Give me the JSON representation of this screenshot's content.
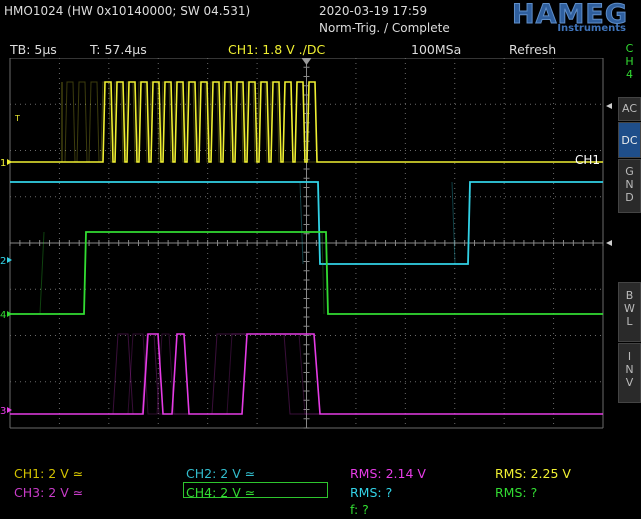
{
  "header": {
    "device": "HMO1024 (HW 0x10140000; SW 04.531)",
    "datetime": "2020-03-19 17:59",
    "trigger_status": "Norm-Trig. / Complete",
    "logo": "HAMEG",
    "logo_sub": "Instruments"
  },
  "settings_bar": {
    "timebase": "TB: 5µs",
    "trigger_time": "T: 57.4µs",
    "ch1_trigger": "CH1: 1.8 V ./DC",
    "sample_rate": "100MSa",
    "mode": "Refresh"
  },
  "side_panel": {
    "ch_select": [
      "C",
      "H",
      "4"
    ],
    "ac": "AC",
    "dc": "DC",
    "gnd": [
      "G",
      "N",
      "D"
    ],
    "bwl": [
      "B",
      "W",
      "L"
    ],
    "inv": [
      "I",
      "N",
      "V"
    ]
  },
  "screen": {
    "ch1_label": "CH1",
    "trigger_marker": "T",
    "markers": [
      "1",
      "2",
      "4",
      "3"
    ]
  },
  "footer": {
    "ch1": "CH1: 2 V ≃",
    "ch2": "CH2: 2 V ≃",
    "ch3": "CH3: 2 V ≃",
    "ch4": "CH4: 2 V ≃",
    "rms_a": "RMS: 2.14 V",
    "rms_b": "RMS: 2.25 V",
    "rms_c": "RMS: ?",
    "rms_d": "RMS: ?",
    "freq": "f: ?"
  },
  "colors": {
    "ch1": "#f0f032",
    "ch2": "#32d2e6",
    "ch3": "#e63ce6",
    "ch4": "#32dc32",
    "grid": "#6a6a6a",
    "accent": "#2f5f9e"
  }
}
